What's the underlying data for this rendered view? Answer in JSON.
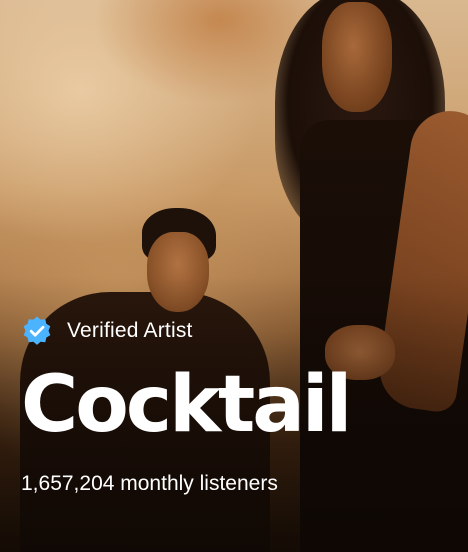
{
  "artist": {
    "verified_label": "Verified Artist",
    "name": "Cocktail",
    "monthly_listeners": "1,657,204 monthly listeners"
  },
  "icons": {
    "verified": "verified-badge-icon"
  },
  "colors": {
    "verified_badge": "#4cb3ff",
    "text": "#ffffff"
  }
}
